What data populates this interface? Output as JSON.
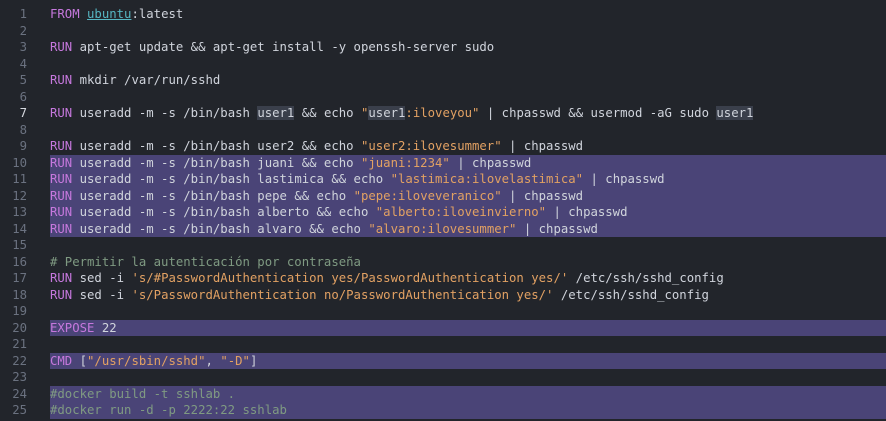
{
  "editor": {
    "theme": {
      "background": "#22252b",
      "selection": "#4a4477",
      "keyword": "#c678dd",
      "string": "#e2a163",
      "comment": "#7f9a82",
      "text": "#d0d4dc",
      "gutter": "#6b7280"
    },
    "current_line": 7,
    "lines": [
      {
        "n": "1",
        "sel": false,
        "tokens": [
          {
            "c": "kw",
            "t": "FROM "
          },
          {
            "c": "lnk",
            "t": "ubuntu"
          },
          {
            "c": "pl",
            "t": ":latest"
          }
        ]
      },
      {
        "n": "2",
        "sel": false,
        "tokens": []
      },
      {
        "n": "3",
        "sel": false,
        "tokens": [
          {
            "c": "kw",
            "t": "RUN "
          },
          {
            "c": "pl",
            "t": "apt-get update && apt-get install -y openssh-server sudo"
          }
        ]
      },
      {
        "n": "4",
        "sel": false,
        "tokens": []
      },
      {
        "n": "5",
        "sel": false,
        "tokens": [
          {
            "c": "kw",
            "t": "RUN "
          },
          {
            "c": "pl",
            "t": "mkdir /var/run/sshd"
          }
        ]
      },
      {
        "n": "6",
        "sel": false,
        "tokens": []
      },
      {
        "n": "7",
        "sel": false,
        "tokens": [
          {
            "c": "kw",
            "t": "RUN "
          },
          {
            "c": "pl",
            "t": "useradd -m -s /bin/bash "
          },
          {
            "c": "hl",
            "t": "user1"
          },
          {
            "c": "pl",
            "t": " && echo "
          },
          {
            "c": "str",
            "t": "\""
          },
          {
            "c": "hl",
            "t": "user1"
          },
          {
            "c": "str",
            "t": ":iloveyou\""
          },
          {
            "c": "pl",
            "t": " | chpasswd && usermod -aG sudo "
          },
          {
            "c": "hl",
            "t": "user1"
          }
        ]
      },
      {
        "n": "8",
        "sel": false,
        "tokens": []
      },
      {
        "n": "9",
        "sel": false,
        "tokens": [
          {
            "c": "kw",
            "t": "RUN "
          },
          {
            "c": "pl",
            "t": "useradd -m -s /bin/bash user2 && echo "
          },
          {
            "c": "str",
            "t": "\"user2:ilovesummer\""
          },
          {
            "c": "pl",
            "t": " | chpasswd"
          }
        ]
      },
      {
        "n": "10",
        "sel": true,
        "tokens": [
          {
            "c": "kw",
            "t": "RUN "
          },
          {
            "c": "pl",
            "t": "useradd -m -s /bin/bash juani && echo "
          },
          {
            "c": "str",
            "t": "\"juani:1234\""
          },
          {
            "c": "pl",
            "t": " | chpasswd"
          }
        ]
      },
      {
        "n": "11",
        "sel": true,
        "tokens": [
          {
            "c": "kw",
            "t": "RUN "
          },
          {
            "c": "pl",
            "t": "useradd -m -s /bin/bash lastimica && echo "
          },
          {
            "c": "str",
            "t": "\"lastimica:ilovelastimica\""
          },
          {
            "c": "pl",
            "t": " | chpasswd"
          }
        ]
      },
      {
        "n": "12",
        "sel": true,
        "tokens": [
          {
            "c": "kw",
            "t": "RUN "
          },
          {
            "c": "pl",
            "t": "useradd -m -s /bin/bash pepe && echo "
          },
          {
            "c": "str",
            "t": "\"pepe:iloveveranico\""
          },
          {
            "c": "pl",
            "t": " | chpasswd"
          }
        ]
      },
      {
        "n": "13",
        "sel": true,
        "tokens": [
          {
            "c": "kw",
            "t": "RUN "
          },
          {
            "c": "pl",
            "t": "useradd -m -s /bin/bash alberto && echo "
          },
          {
            "c": "str",
            "t": "\"alberto:iloveinvierno\""
          },
          {
            "c": "pl",
            "t": " | chpasswd"
          }
        ]
      },
      {
        "n": "14",
        "sel": true,
        "tokens": [
          {
            "c": "kw",
            "t": "RUN "
          },
          {
            "c": "pl",
            "t": "useradd -m -s /bin/bash alvaro && echo "
          },
          {
            "c": "str",
            "t": "\"alvaro:ilovesummer\""
          },
          {
            "c": "pl",
            "t": " | chpasswd"
          }
        ]
      },
      {
        "n": "15",
        "sel": false,
        "tokens": []
      },
      {
        "n": "16",
        "sel": false,
        "tokens": [
          {
            "c": "cmt",
            "t": "# Permitir la autenticación por contraseña"
          }
        ]
      },
      {
        "n": "17",
        "sel": false,
        "tokens": [
          {
            "c": "kw",
            "t": "RUN "
          },
          {
            "c": "pl",
            "t": "sed -i "
          },
          {
            "c": "str",
            "t": "'s/#PasswordAuthentication yes/PasswordAuthentication yes/'"
          },
          {
            "c": "pl",
            "t": " /etc/ssh/sshd_config"
          }
        ]
      },
      {
        "n": "18",
        "sel": false,
        "tokens": [
          {
            "c": "kw",
            "t": "RUN "
          },
          {
            "c": "pl",
            "t": "sed -i "
          },
          {
            "c": "str",
            "t": "'s/PasswordAuthentication no/PasswordAuthentication yes/'"
          },
          {
            "c": "pl",
            "t": " /etc/ssh/sshd_config"
          }
        ]
      },
      {
        "n": "19",
        "sel": false,
        "tokens": []
      },
      {
        "n": "20",
        "sel": true,
        "tokens": [
          {
            "c": "kw",
            "t": "EXPOSE "
          },
          {
            "c": "pl",
            "t": "22"
          }
        ]
      },
      {
        "n": "21",
        "sel": false,
        "tokens": []
      },
      {
        "n": "22",
        "sel": true,
        "tokens": [
          {
            "c": "kw",
            "t": "CMD "
          },
          {
            "c": "pl",
            "t": "["
          },
          {
            "c": "str",
            "t": "\"/usr/sbin/sshd\""
          },
          {
            "c": "pl",
            "t": ", "
          },
          {
            "c": "str",
            "t": "\"-D\""
          },
          {
            "c": "pl",
            "t": "]"
          }
        ]
      },
      {
        "n": "23",
        "sel": false,
        "tokens": []
      },
      {
        "n": "24",
        "sel": true,
        "tokens": [
          {
            "c": "cmt",
            "t": "#docker build -t sshlab ."
          }
        ]
      },
      {
        "n": "25",
        "sel": true,
        "tokens": [
          {
            "c": "cmt",
            "t": "#docker run -d -p 2222:22 sshlab"
          }
        ]
      }
    ]
  }
}
